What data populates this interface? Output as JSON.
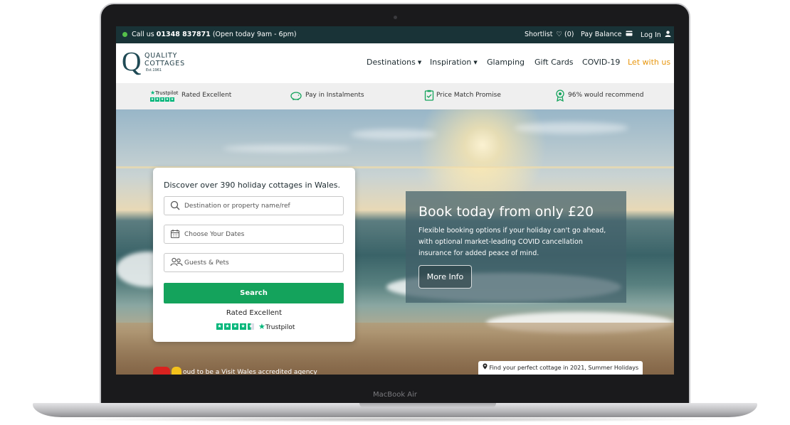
{
  "device": {
    "label": "MacBook Air"
  },
  "topbar": {
    "call_prefix": "Call us",
    "phone": "01348 837871",
    "hours": "(Open today 9am - 6pm)",
    "shortlist": "Shortlist",
    "shortlist_count": "(0)",
    "pay_balance": "Pay Balance",
    "login": "Log In"
  },
  "logo": {
    "line1": "QUALITY",
    "line2": "COTTAGES",
    "line3": "Est.1961",
    "mark": "Q"
  },
  "nav": {
    "items": [
      {
        "label": "Destinations",
        "has_caret": true
      },
      {
        "label": "Inspiration",
        "has_caret": true
      },
      {
        "label": "Glamping"
      },
      {
        "label": "Gift Cards"
      },
      {
        "label": "COVID-19"
      },
      {
        "label": "Let with us"
      }
    ],
    "accent_color": "#e8970f"
  },
  "trustbar": {
    "trustpilot_word": "Trustpilot",
    "rated": "Rated Excellent",
    "instalments": "Pay in Instalments",
    "price_match": "Price Match Promise",
    "recommend": "96% would recommend"
  },
  "search": {
    "title": "Discover over 390 holiday cottages in Wales.",
    "destination_placeholder": "Destination or property name/ref",
    "dates_placeholder": "Choose Your Dates",
    "guests_placeholder": "Guests & Pets",
    "button": "Search",
    "rated": "Rated Excellent",
    "trustpilot": "Trustpilot",
    "button_color": "#14a35c"
  },
  "promo": {
    "title": "Book today from only £20",
    "text": "Flexible booking options if your holiday can't go ahead, with optional market-leading COVID cancellation insurance for added peace of mind.",
    "button": "More Info"
  },
  "caption": "Find your perfect cottage in 2021, Summer Holidays",
  "visit_wales": "oud to be a Visit Wales accredited agency"
}
